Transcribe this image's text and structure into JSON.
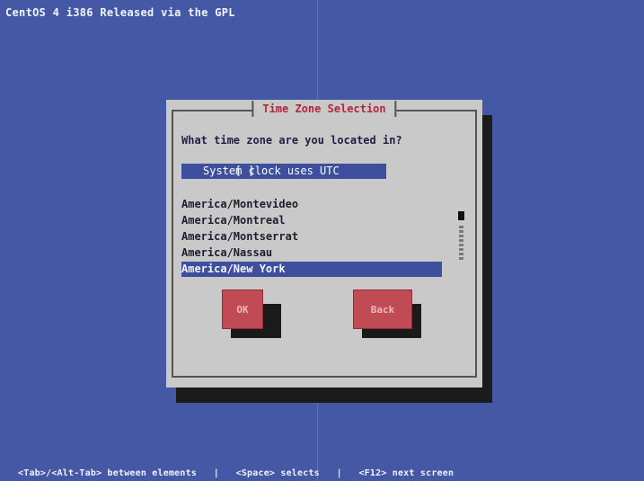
{
  "screen": {
    "top_banner": "CentOS 4 i386 Released via the GPL",
    "bottom_help": "<Tab>/<Alt-Tab> between elements   |   <Space> selects   |   <F12> next screen"
  },
  "dialog": {
    "title": "Time Zone Selection",
    "question": "What time zone are you located in?",
    "utc_checkbox": {
      "state_mark": " ",
      "label": "System clock uses UTC"
    },
    "timezones": [
      {
        "label": "America/Montevideo",
        "selected": false
      },
      {
        "label": "America/Montreal",
        "selected": false
      },
      {
        "label": "America/Montserrat",
        "selected": false
      },
      {
        "label": "America/Nassau",
        "selected": false
      },
      {
        "label": "America/New York",
        "selected": true
      }
    ],
    "buttons": {
      "ok": "OK",
      "back": "Back"
    }
  },
  "colors": {
    "background": "#4458a6",
    "dialog_bg": "#c9c9c9",
    "selection": "#3e4f9e",
    "title": "#b3263d",
    "button": "#c04b54"
  },
  "icons": {
    "scrollbar": "list-scrollbar-icon"
  }
}
